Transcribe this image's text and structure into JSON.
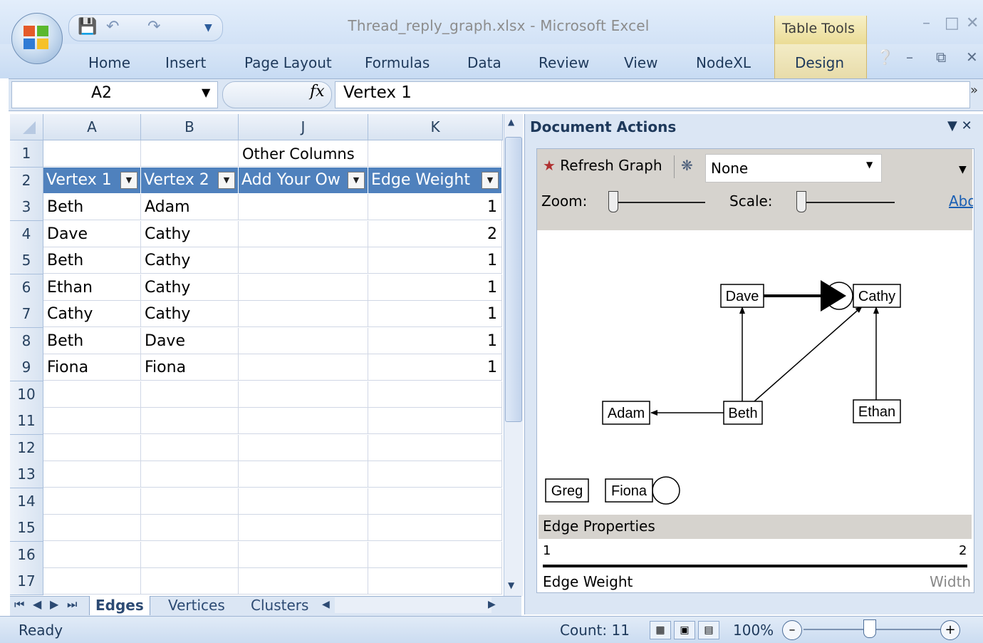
{
  "window": {
    "title": "Thread_reply_graph.xlsx - Microsoft Excel",
    "contextual_group": "Table Tools"
  },
  "ribbon": {
    "tabs": [
      "Home",
      "Insert",
      "Page Layout",
      "Formulas",
      "Data",
      "Review",
      "View",
      "NodeXL",
      "Design"
    ]
  },
  "formula_bar": {
    "name_box": "A2",
    "fx": "fx",
    "content": "Vertex 1"
  },
  "grid": {
    "columns": [
      "A",
      "B",
      "J",
      "K"
    ],
    "row_numbers": [
      "1",
      "2",
      "3",
      "4",
      "5",
      "6",
      "7",
      "8",
      "9",
      "10",
      "11",
      "12",
      "13",
      "14",
      "15",
      "16",
      "17"
    ],
    "group_header": "Other Columns",
    "table_headers": [
      "Vertex 1",
      "Vertex 2",
      "Add Your Ow",
      "Edge Weight"
    ],
    "rows": [
      [
        "Beth",
        "Adam",
        "",
        "1"
      ],
      [
        "Dave",
        "Cathy",
        "",
        "2"
      ],
      [
        "Beth",
        "Cathy",
        "",
        "1"
      ],
      [
        "Ethan",
        "Cathy",
        "",
        "1"
      ],
      [
        "Cathy",
        "Cathy",
        "",
        "1"
      ],
      [
        "Beth",
        "Dave",
        "",
        "1"
      ],
      [
        "Fiona",
        "Fiona",
        "",
        "1"
      ]
    ]
  },
  "sheet_tabs": [
    "Edges",
    "Vertices",
    "Clusters"
  ],
  "document_actions": {
    "title": "Document Actions",
    "refresh_label": "Refresh Graph",
    "layout_value": "None",
    "zoom_label": "Zoom:",
    "scale_label": "Scale:",
    "about_link": "About",
    "graph": {
      "nodes": [
        "Dave",
        "Cathy",
        "Adam",
        "Beth",
        "Ethan",
        "Greg",
        "Fiona"
      ],
      "edges": [
        [
          "Beth",
          "Adam"
        ],
        [
          "Dave",
          "Cathy"
        ],
        [
          "Beth",
          "Cathy"
        ],
        [
          "Ethan",
          "Cathy"
        ],
        [
          "Cathy",
          "Cathy"
        ],
        [
          "Beth",
          "Dave"
        ],
        [
          "Fiona",
          "Fiona"
        ]
      ]
    },
    "edge_properties": {
      "title": "Edge Properties",
      "min": "1",
      "max": "2",
      "property": "Edge Weight",
      "visual": "Width"
    }
  },
  "status_bar": {
    "ready": "Ready",
    "count": "Count: 11",
    "zoom": "100%"
  },
  "colors": {
    "table_header": "#4f81bd",
    "ribbon_bg": "#dae7f7",
    "contextual": "#eadb93"
  }
}
